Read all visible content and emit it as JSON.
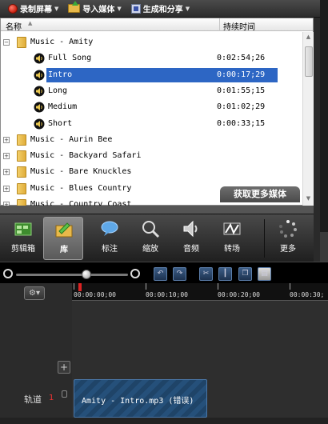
{
  "toolbar": {
    "record_label": "录制屏幕",
    "import_label": "导入媒体",
    "produce_label": "生成和分享"
  },
  "library": {
    "col_name": "名称",
    "col_duration": "持续时间",
    "items": [
      {
        "type": "folder",
        "expanded": true,
        "label": "Music - Amity"
      },
      {
        "type": "clip",
        "label": "Full Song",
        "duration": "0:02:54;26"
      },
      {
        "type": "clip",
        "label": "Intro",
        "duration": "0:00:17;29",
        "selected": true
      },
      {
        "type": "clip",
        "label": "Long",
        "duration": "0:01:55;15"
      },
      {
        "type": "clip",
        "label": "Medium",
        "duration": "0:01:02;29"
      },
      {
        "type": "clip",
        "label": "Short",
        "duration": "0:00:33;15"
      },
      {
        "type": "folder",
        "expanded": false,
        "label": "Music - Aurin Bee"
      },
      {
        "type": "folder",
        "expanded": false,
        "label": "Music - Backyard Safari"
      },
      {
        "type": "folder",
        "expanded": false,
        "label": "Music - Bare Knuckles"
      },
      {
        "type": "folder",
        "expanded": false,
        "label": "Music - Blues Country"
      },
      {
        "type": "folder",
        "expanded": false,
        "label": "Music - Country Coast"
      }
    ],
    "get_more": "获取更多媒体"
  },
  "tasks": [
    {
      "label": "剪辑箱",
      "icon": "clip-bin-icon"
    },
    {
      "label": "库",
      "icon": "library-folder-icon",
      "active": true
    },
    {
      "label": "标注",
      "icon": "callout-icon"
    },
    {
      "label": "缩放",
      "icon": "zoom-magnifier-icon"
    },
    {
      "label": "音频",
      "icon": "audio-speaker-icon"
    },
    {
      "label": "转场",
      "icon": "transition-icon"
    },
    {
      "label": "更多",
      "icon": "more-icon"
    }
  ],
  "timeline": {
    "ticks": [
      "00:00:00;00",
      "00:00:10;00",
      "00:00:20;00",
      "00:00:30;"
    ],
    "track_label": "轨道",
    "track_number": "1",
    "clip_label": "Amity - Intro.mp3 (错误)",
    "zoom_level_fraction": 0.63
  },
  "colors": {
    "selection": "#2d66c4",
    "playhead": "#dd2222",
    "clip": "#25507a"
  }
}
